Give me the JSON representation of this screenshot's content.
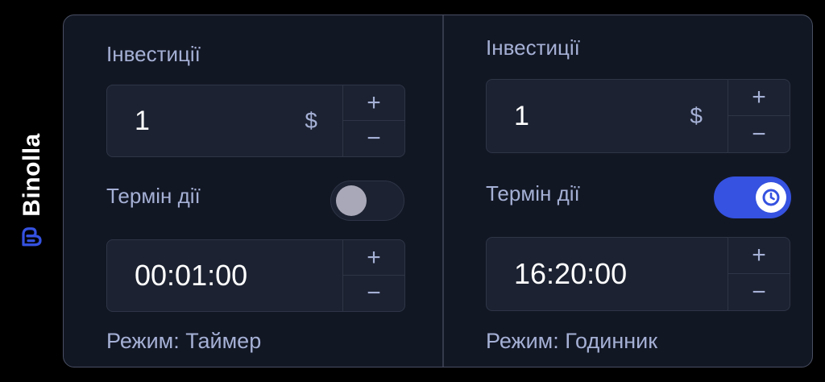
{
  "brand": {
    "name": "Binolla",
    "color": "#3552e0"
  },
  "left": {
    "investment_label": "Інвестиції",
    "investment_value": "1",
    "currency": "$",
    "plus": "+",
    "minus": "−",
    "expiry_label": "Термін дії",
    "expiry_toggle_on": false,
    "time_value": "00:01:00",
    "mode_text": "Режим: Таймер"
  },
  "right": {
    "investment_label": "Інвестиції",
    "investment_value": "1",
    "currency": "$",
    "plus": "+",
    "minus": "−",
    "expiry_label": "Термін дії",
    "expiry_toggle_on": true,
    "toggle_icon": "clock-icon",
    "time_value": "16:20:00",
    "mode_text": "Режим: Годинник"
  }
}
